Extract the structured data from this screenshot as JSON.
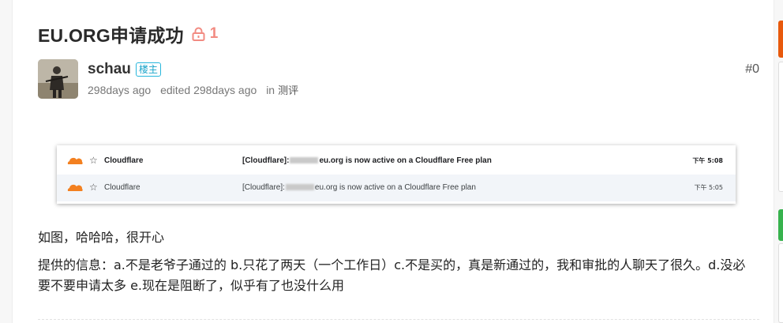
{
  "topic": {
    "title": "EU.ORG申请成功",
    "lock_count": "1"
  },
  "post": {
    "author": "schau",
    "badge": "楼主",
    "created": "298days ago",
    "edited": "edited 298days ago",
    "in_label": "in",
    "category": "测评",
    "floor": "#0"
  },
  "email_screenshot": {
    "rows": [
      {
        "sender": "Cloudflare",
        "subject_prefix": "[Cloudflare]:",
        "subject_suffix": "eu.org is now active on a Cloudflare Free plan",
        "time": "下午 5:08",
        "unread": true
      },
      {
        "sender": "Cloudflare",
        "subject_prefix": "[Cloudflare]:",
        "subject_suffix": "eu.org is now active on a Cloudflare Free plan",
        "time": "下午 5:05",
        "unread": false
      }
    ]
  },
  "content": {
    "line1": "如图，哈哈哈，很开心",
    "line2": "提供的信息：a.不是老爷子通过的 b.只花了两天（一个工作日）c.不是买的，真是新通过的，我和审批的人聊天了很久。d.没必要不要申请太多 e.现在是阻断了，似乎有了也没什么用"
  },
  "colors": {
    "lock": "#f28b82",
    "badge": "#27b6dc",
    "cloudflare_orange": "#f38020",
    "edge_orange": "#e8590c",
    "edge_green": "#37b24d"
  }
}
